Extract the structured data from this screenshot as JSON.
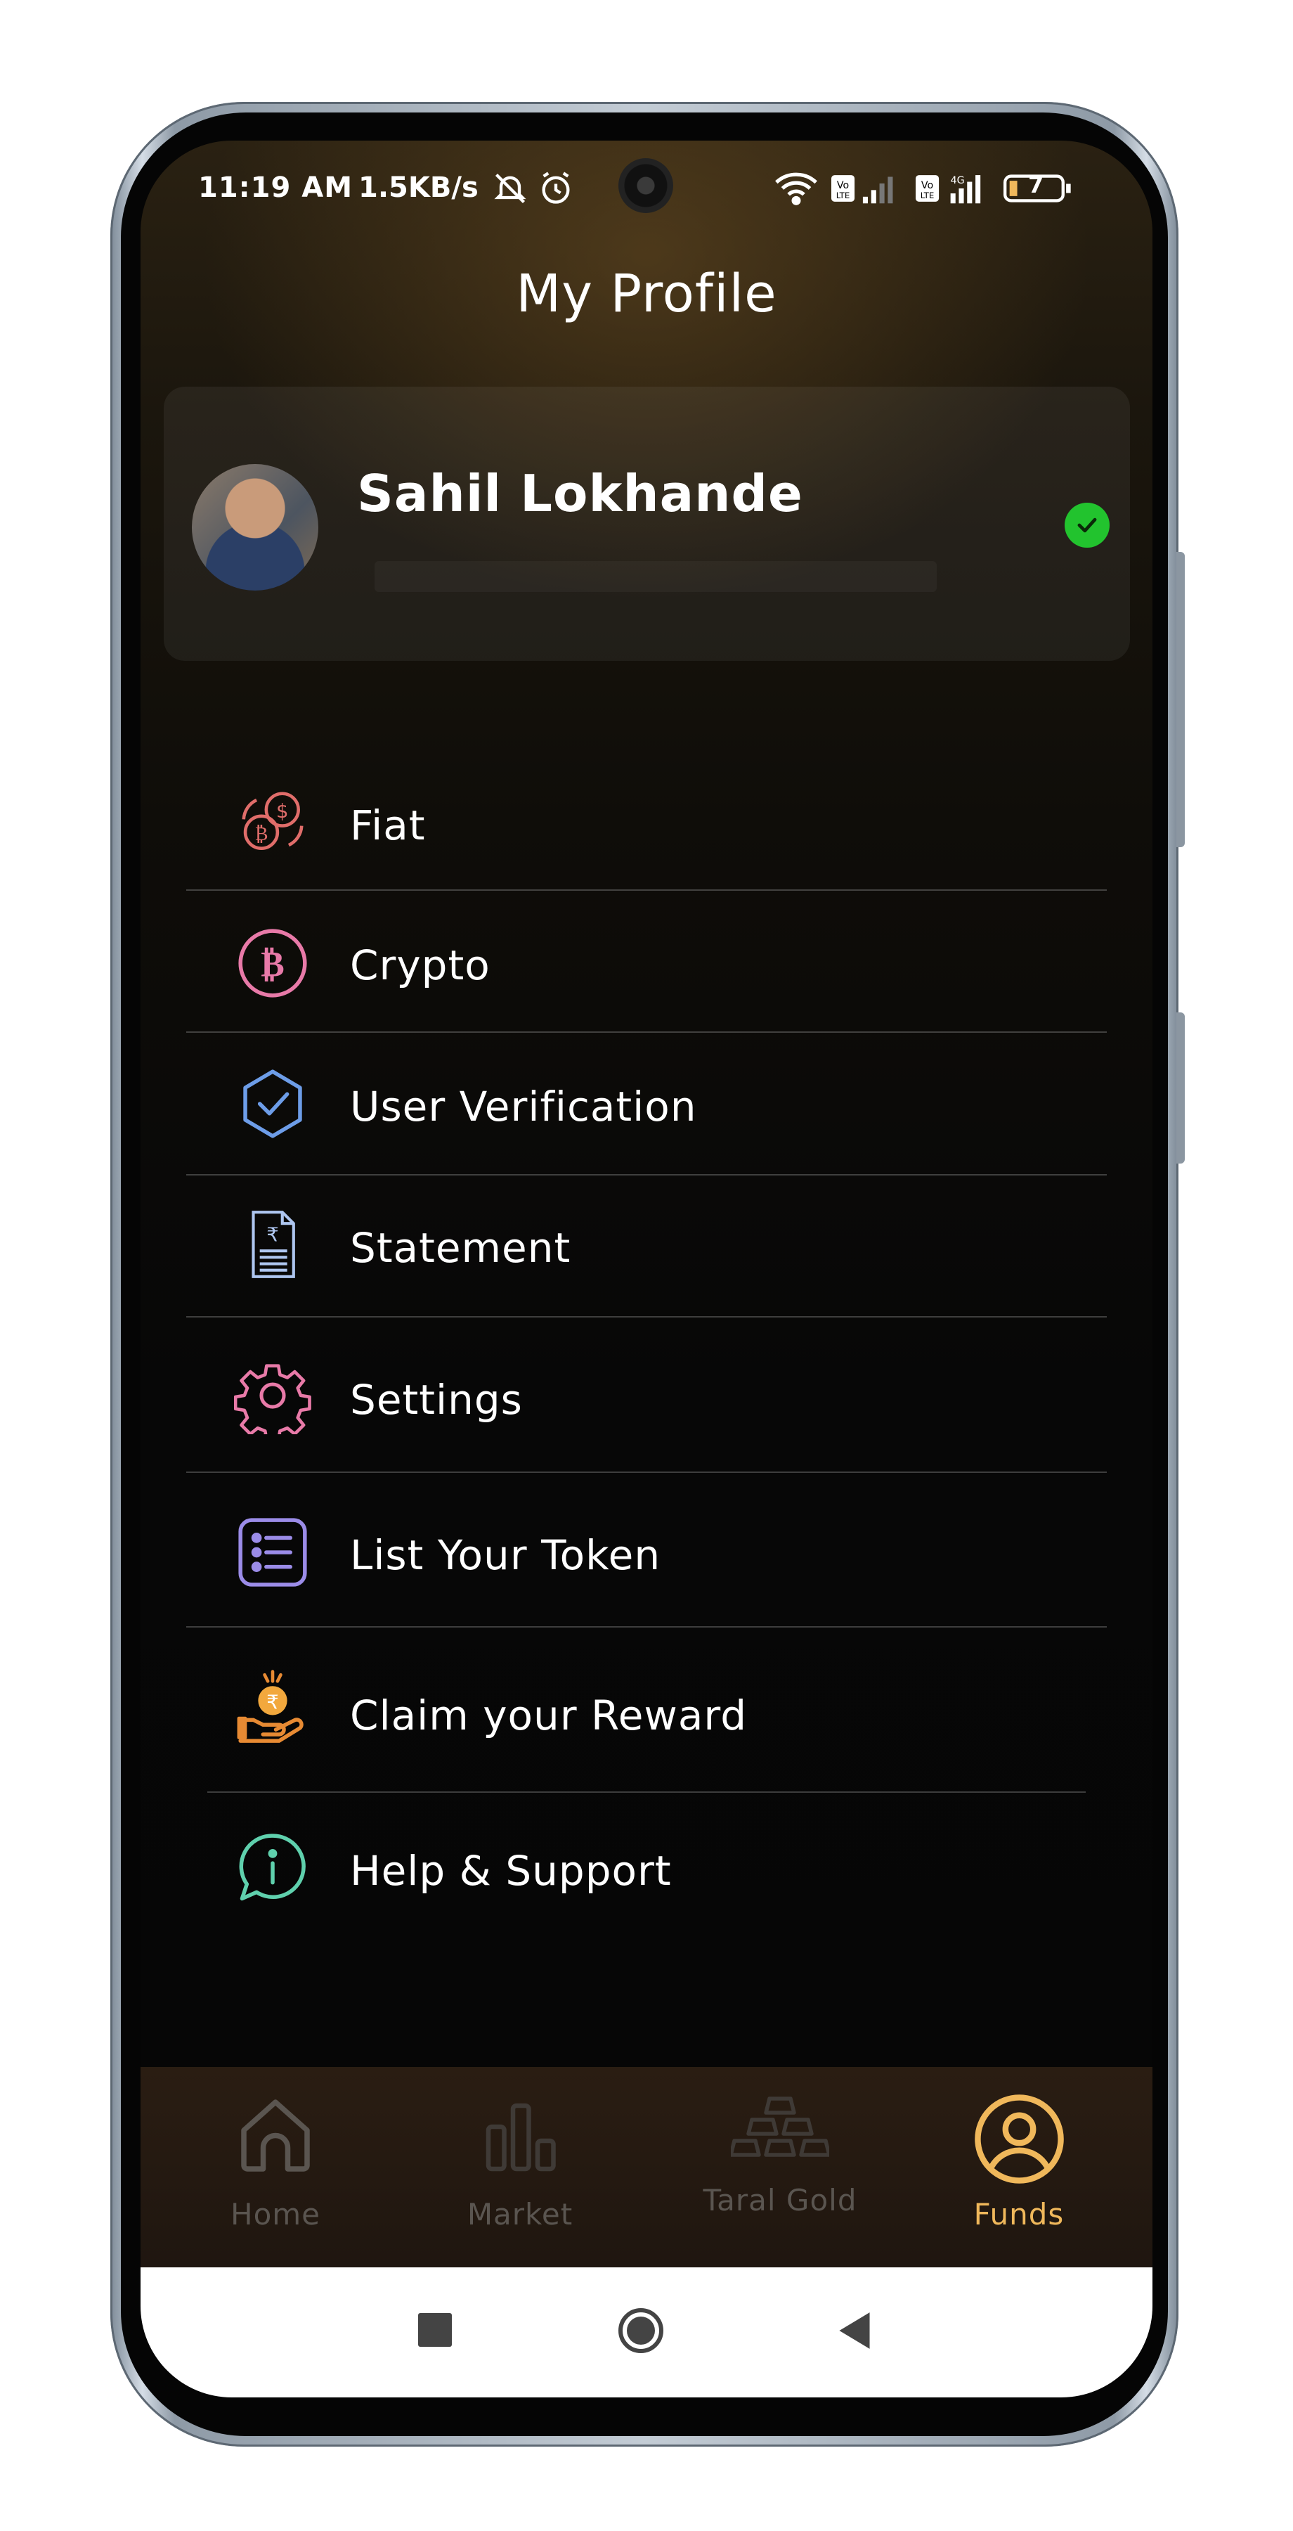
{
  "status_bar": {
    "time": "11:19 AM",
    "speed": "1.5KB/s",
    "network_type": "4G",
    "battery": "7"
  },
  "header": {
    "title": "My Profile"
  },
  "profile": {
    "name": "Sahil Lokhande",
    "verified": true
  },
  "menu": [
    {
      "label": "Fiat",
      "icon": "fiat-coins-icon"
    },
    {
      "label": "Crypto",
      "icon": "bitcoin-icon"
    },
    {
      "label": "User Verification",
      "icon": "shield-check-icon"
    },
    {
      "label": "Statement",
      "icon": "statement-document-icon"
    },
    {
      "label": "Settings",
      "icon": "gear-icon"
    },
    {
      "label": "List Your Token",
      "icon": "list-icon"
    },
    {
      "label": "Claim your Reward",
      "icon": "reward-hand-coin-icon"
    },
    {
      "label": "Help & Support",
      "icon": "info-chat-icon"
    }
  ],
  "bottom_nav": {
    "items": [
      {
        "label": "Home",
        "icon": "home-icon",
        "active": false
      },
      {
        "label": "Market",
        "icon": "bar-chart-icon",
        "active": false
      },
      {
        "label": "Taral Gold",
        "icon": "gold-bars-icon",
        "active": false
      },
      {
        "label": "Funds",
        "icon": "user-circle-icon",
        "active": true
      }
    ]
  },
  "system_nav": {
    "buttons": [
      "recents-button",
      "home-button",
      "back-button"
    ]
  },
  "colors": {
    "accent_gold": "#f0b85b",
    "inactive_nav": "#5a5550",
    "verified_green": "#22c32e",
    "text": "#ffffff"
  }
}
